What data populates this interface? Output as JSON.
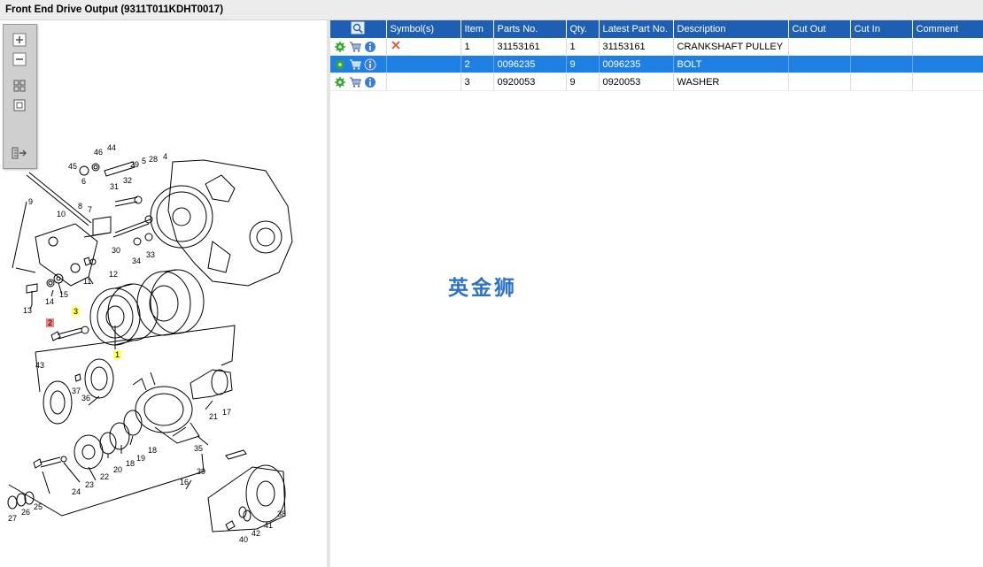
{
  "window": {
    "title": "Front End Drive Output (9311T011KDHT0017)"
  },
  "toolbar": {
    "buttons": [
      {
        "name": "zoom-in-button",
        "icon": "zoom-in-icon"
      },
      {
        "name": "zoom-out-button",
        "icon": "zoom-out-icon"
      },
      {
        "name": "fit-grid-button",
        "icon": "grid-icon"
      },
      {
        "name": "actual-size-button",
        "icon": "square-icon"
      },
      {
        "name": "export-button",
        "icon": "export-arrow-icon"
      }
    ]
  },
  "diagram": {
    "callouts": {
      "c1": "1",
      "c2": "2",
      "c3": "3"
    },
    "labels": [
      "44",
      "46",
      "45",
      "6",
      "29",
      "5",
      "28",
      "4",
      "31",
      "32",
      "9",
      "10",
      "8",
      "7",
      "30",
      "34",
      "33",
      "12",
      "11",
      "13",
      "14",
      "15",
      "43",
      "37",
      "36",
      "21",
      "17",
      "39",
      "35",
      "16",
      "18",
      "19",
      "20",
      "22",
      "23",
      "24",
      "27",
      "26",
      "25",
      "38",
      "41",
      "42",
      "40"
    ],
    "highlight_colors": {
      "red": "#f08080",
      "yellow": "#ffff66"
    }
  },
  "table": {
    "columns": [
      "",
      "Symbol(s)",
      "Item",
      "Parts No.",
      "Qty.",
      "Latest Part No.",
      "Description",
      "Cut Out",
      "Cut In",
      "Comment"
    ],
    "rows": [
      {
        "symbol": "x-icon",
        "item": "1",
        "parts_no": "31153161",
        "qty": "1",
        "latest_part_no": "31153161",
        "description": "CRANKSHAFT PULLEY",
        "cut_out": "",
        "cut_in": "",
        "comment": "",
        "selected": false
      },
      {
        "symbol": "",
        "item": "2",
        "parts_no": "0096235",
        "qty": "9",
        "latest_part_no": "0096235",
        "description": "BOLT",
        "cut_out": "",
        "cut_in": "",
        "comment": "",
        "selected": true
      },
      {
        "symbol": "",
        "item": "3",
        "parts_no": "0920053",
        "qty": "9",
        "latest_part_no": "0920053",
        "description": "WASHER",
        "cut_out": "",
        "cut_in": "",
        "comment": "",
        "selected": false
      }
    ],
    "row_icons": [
      "gear-icon",
      "cart-icon",
      "info-icon"
    ]
  },
  "watermark": "英金狮",
  "colors": {
    "header_blue": "#1e5fb3",
    "selection_blue": "#1f7fe3",
    "delete_orange": "#e0502a",
    "info_blue": "#3b7dd8",
    "gear_green": "#3aa53a"
  }
}
